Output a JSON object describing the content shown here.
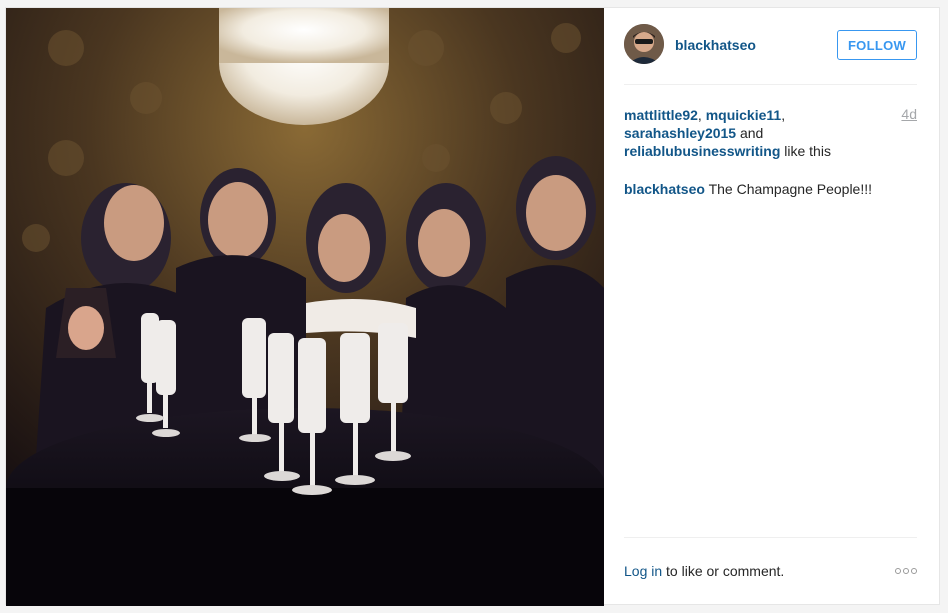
{
  "post": {
    "photo": {
      "alt": ""
    },
    "author": {
      "username": "blackhatseo",
      "avatar_icon": "profile-avatar"
    },
    "follow_label": "FOLLOW",
    "likes": {
      "users": [
        "mattlittle92",
        "mquickie11",
        "sarahashley2015",
        "reliablubusinesswriting"
      ],
      "sep1": ", ",
      "sep2": ",",
      "sep3": " and",
      "suffix": " like this"
    },
    "age": "4d",
    "caption": {
      "username": "blackhatseo",
      "text": " The Champagne People!!!"
    },
    "footer": {
      "login_label": "Log in",
      "rest": " to like or comment."
    },
    "more_icon": "ellipsis-icon"
  },
  "colors": {
    "link": "#125688",
    "follow": "#3897f0",
    "muted": "#a5a7aa",
    "divider": "#efefef"
  }
}
